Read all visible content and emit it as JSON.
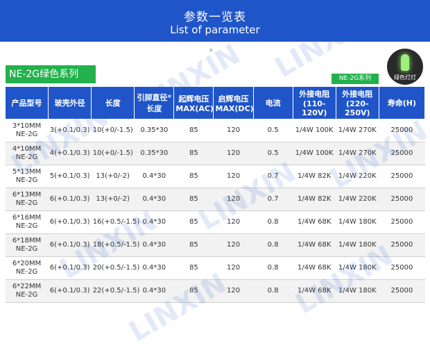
{
  "header": {
    "title_cn": "参数一览表",
    "title_en": "List of parameter",
    "dot": "。"
  },
  "series_label": "NE-2G绿色系列",
  "badge_label": "NE-2G系列",
  "lamp_caption": "绿色灯灯",
  "watermark": "LINXIN",
  "table": {
    "headers": [
      "产品型号",
      "玻壳外径",
      "长度",
      "引脚直径*长度",
      "起辉电压MAX(AC)",
      "启辉电压MAX(DC)",
      "电流",
      "外接电阻(110-120V)",
      "外接电阻(220-250V)",
      "寿命(H)"
    ],
    "rows": [
      [
        "3*10MM NE-2G",
        "3(+0.1/0.3)",
        "10(+0/-1.5)",
        "0.35*30",
        "85",
        "120",
        "0.5",
        "1/4W 100K",
        "1/4W 270K",
        "25000"
      ],
      [
        "4*10MM NE-2G",
        "4(+0.1/0.3)",
        "10(+0/-1.5)",
        "0.35*30",
        "85",
        "120",
        "0.5",
        "1/4W 100K",
        "1/4W 270K",
        "25000"
      ],
      [
        "5*13MM NE-2G",
        "5(+0.1/0.3)",
        "13(+0/-2)",
        "0.4*30",
        "85",
        "120",
        "0.7",
        "1/4W 82K",
        "1/4W 220K",
        "25000"
      ],
      [
        "6*13MM NE-2G",
        "6(+0.1/0.3)",
        "13(+0/-2)",
        "0.4*30",
        "85",
        "120",
        "0.7",
        "1/4W 82K",
        "1/4W 220K",
        "25000"
      ],
      [
        "6*16MM NE-2G",
        "6(+0.1/0.3)",
        "16(+0.5/-1.5)",
        "0.4*30",
        "85",
        "120",
        "0.8",
        "1/4W 68K",
        "1/4W 180K",
        "25000"
      ],
      [
        "6*18MM NE-2G",
        "6(+0.1/0.3)",
        "18(+0.5/-1.5)",
        "0.4*30",
        "85",
        "120",
        "0.8",
        "1/4W 68K",
        "1/4W 180K",
        "25000"
      ],
      [
        "6*20MM NE-2G",
        "6(+0.1/0.3)",
        "20(+0.5/-1.5)",
        "0.4*30",
        "85",
        "120",
        "0.8",
        "1/4W 68K",
        "1/4W 180K",
        "25000"
      ],
      [
        "6*22MM NE-2G",
        "6(+0.1/0.3)",
        "22(+0.5/-1.5)",
        "0.4*30",
        "85",
        "120",
        "0.8",
        "1/4W 68K",
        "1/4W 180K",
        "25000"
      ]
    ]
  }
}
